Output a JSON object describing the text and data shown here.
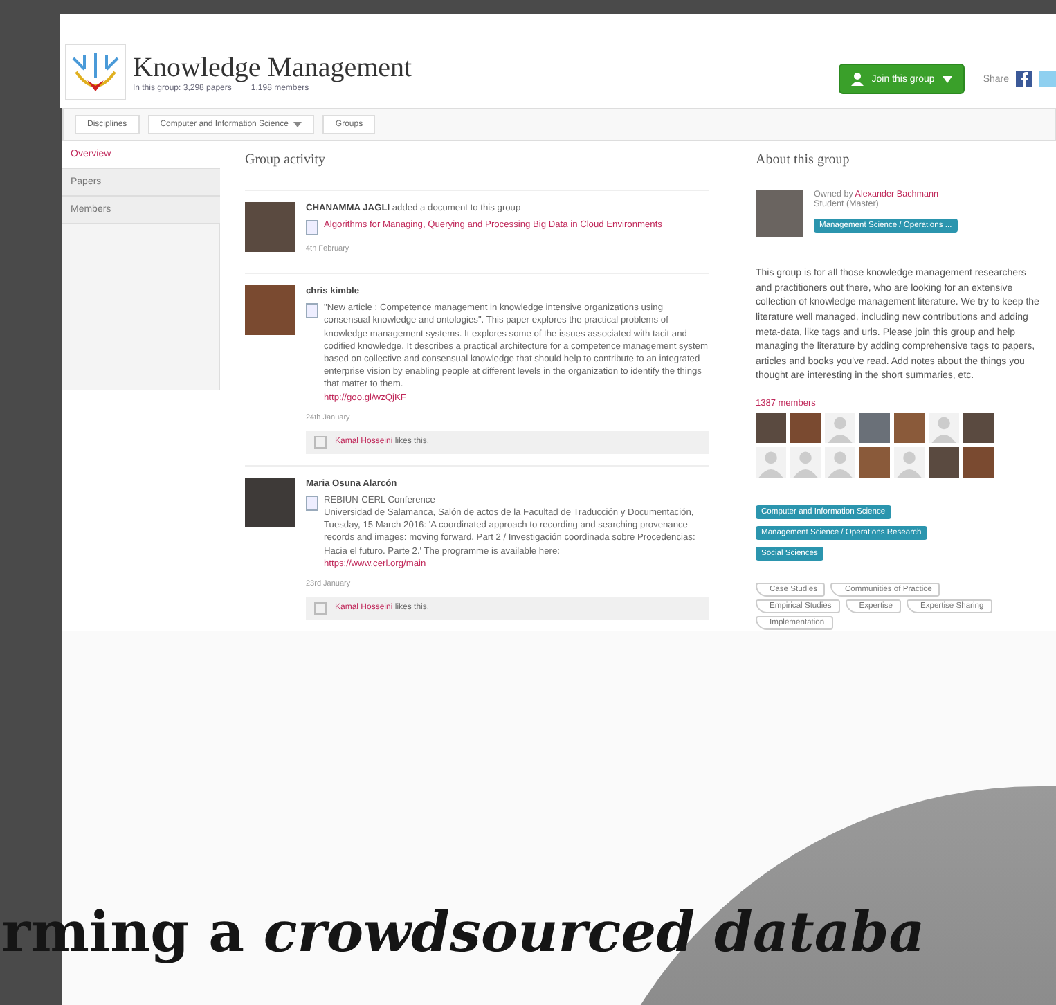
{
  "header": {
    "title": "Knowledge Management",
    "stats": [
      "In this group: 3,298 papers",
      "1,198 members"
    ],
    "join_button": "Join this group",
    "share_label": "Share"
  },
  "breadcrumb": [
    {
      "label": "Disciplines",
      "dropdown": false
    },
    {
      "label": "Computer and Information Science",
      "dropdown": true
    },
    {
      "label": "Groups",
      "dropdown": false
    }
  ],
  "sidebar": {
    "items": [
      {
        "label": "Overview",
        "selected": true
      },
      {
        "label": "Papers",
        "selected": false
      },
      {
        "label": "Members",
        "selected": false
      }
    ]
  },
  "activity": {
    "heading": "Group activity",
    "items": [
      {
        "author": "CHANAMMA JAGLI",
        "action": " added a document to this group",
        "document": "Algorithms for Managing, Querying and Processing Big Data in Cloud Environments",
        "date": "4th February"
      },
      {
        "author": "chris kimble",
        "text": "\"New article : Competence management in knowledge intensive organizations using consensual knowledge and ontologies\". This paper explores the practical problems of knowledge management systems. It explores some of the issues associated with tacit and codified knowledge. It describes a practical architecture for a competence management system based on collective and consensual knowledge that should help to contribute to an integrated enterprise vision by enabling people at different levels in the organization to identify the things that matter to them.",
        "link": "http://goo.gl/wzQjKF",
        "date": "24th January",
        "liker": "Kamal Hosseini",
        "likes_text": " likes this."
      },
      {
        "author": "Maria Osuna Alarcón",
        "heading": "REBIUN-CERL Conference",
        "text": "Universidad de Salamanca, Salón de actos de la Facultad de Traducción y Documentación, Tuesday, 15 March 2016: 'A coordinated approach to recording and searching provenance records and images: moving forward. Part 2 / Investigación coordinada sobre Procedencias: Hacia el futuro. Parte 2.' The programme is available here:",
        "link": "https://www.cerl.org/main",
        "date": "23rd January",
        "liker": "Kamal Hosseini",
        "likes_text": " likes this."
      }
    ]
  },
  "about": {
    "heading": "About this group",
    "owned_by": "Owned by ",
    "owner": "Alexander Bachmann",
    "owner_role": "Student (Master)",
    "owner_discipline": "Management Science / Operations ...",
    "description": "This group is for all those knowledge management researchers and practitioners out there, who are looking for an extensive collection of knowledge management literature. We try to keep the literature well managed, including new contributions and adding meta-data, like tags and urls. Please join this group and help managing the literature by adding comprehensive tags to papers, articles and books you've read. Add notes about the things you thought are interesting in the short summaries, etc.",
    "members_label": "1387 members",
    "members": [
      {
        "kind": "photo"
      },
      {
        "kind": "photo"
      },
      {
        "kind": "default"
      },
      {
        "kind": "photo"
      },
      {
        "kind": "photo"
      },
      {
        "kind": "default"
      },
      {
        "kind": "photo"
      },
      {
        "kind": "default"
      },
      {
        "kind": "default"
      },
      {
        "kind": "default"
      },
      {
        "kind": "photo"
      },
      {
        "kind": "default"
      },
      {
        "kind": "photo"
      },
      {
        "kind": "photo"
      }
    ],
    "disciplines": [
      "Computer and Information Science",
      "Management Science / Operations Research",
      "Social Sciences"
    ],
    "tags": [
      "Case Studies",
      "Communities of Practice",
      "Empirical Studies",
      "Expertise",
      "Expertise Sharing",
      "Implementation"
    ]
  },
  "caption": "rming a *crowdsourced databa*"
}
